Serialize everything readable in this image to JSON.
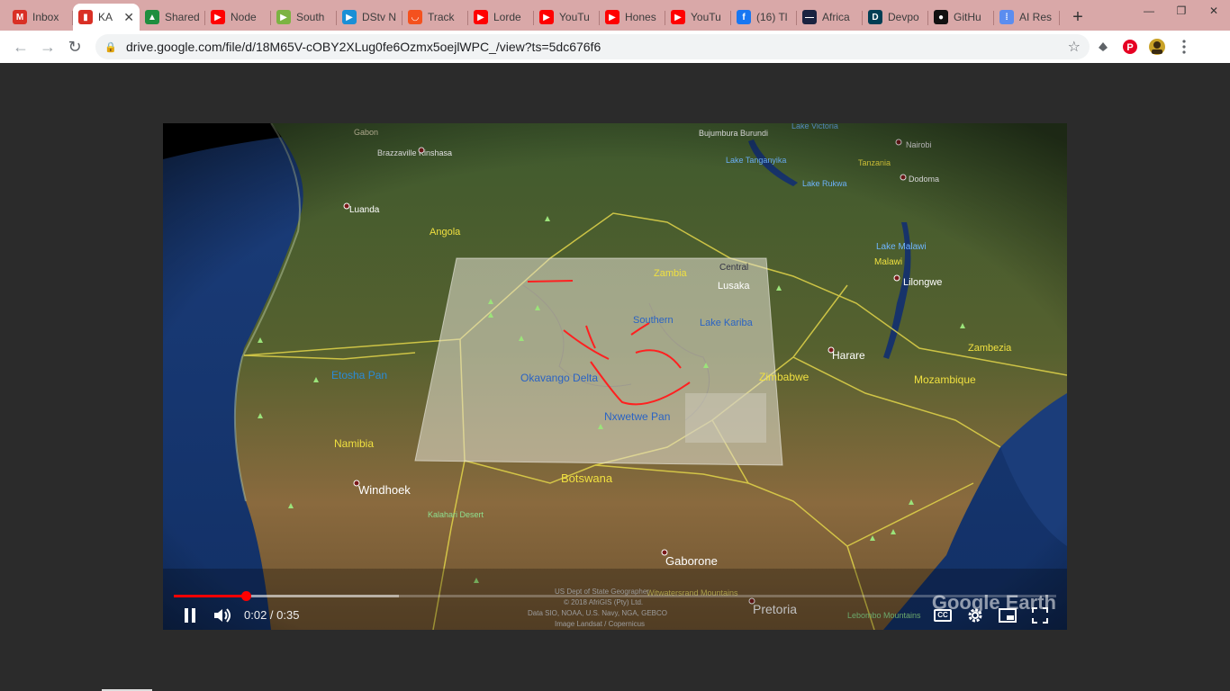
{
  "tabs": [
    {
      "label": "Inbox",
      "icon": "gmail-icon",
      "color": "#d93025",
      "glyph": "M"
    },
    {
      "label": "KA",
      "icon": "clapper-icon",
      "color": "#d93025",
      "glyph": "▮",
      "active": true
    },
    {
      "label": "Shared",
      "icon": "drive-icon",
      "color": "#1e8e3e",
      "glyph": "▲"
    },
    {
      "label": "Node",
      "icon": "youtube-icon",
      "color": "#ff0000",
      "glyph": "▶"
    },
    {
      "label": "South",
      "icon": "play-icon",
      "color": "#7cb342",
      "glyph": "▶"
    },
    {
      "label": "DStv N",
      "icon": "dstv-icon",
      "color": "#1a8fd6",
      "glyph": "▶"
    },
    {
      "label": "Track",
      "icon": "tracker-icon",
      "color": "#f4511e",
      "glyph": "◡"
    },
    {
      "label": "Lorde",
      "icon": "youtube-icon",
      "color": "#ff0000",
      "glyph": "▶"
    },
    {
      "label": "YouTu",
      "icon": "youtube-icon",
      "color": "#ff0000",
      "glyph": "▶"
    },
    {
      "label": "Hones",
      "icon": "youtube-icon",
      "color": "#ff0000",
      "glyph": "▶"
    },
    {
      "label": "YouTu",
      "icon": "youtube-icon",
      "color": "#ff0000",
      "glyph": "▶"
    },
    {
      "label": "(16) Tl",
      "icon": "facebook-icon",
      "color": "#1877f2",
      "glyph": "f"
    },
    {
      "label": "Africa",
      "icon": "africa-icon",
      "color": "#1a2340",
      "glyph": "—"
    },
    {
      "label": "Devpo",
      "icon": "devpost-icon",
      "color": "#003e54",
      "glyph": "D"
    },
    {
      "label": "GitHu",
      "icon": "github-icon",
      "color": "#111111",
      "glyph": "●"
    },
    {
      "label": "AI Res",
      "icon": "ai-res-icon",
      "color": "#5b8def",
      "glyph": "⁞"
    }
  ],
  "address": {
    "url": "drive.google.com/file/d/18M65V-cOBY2XLug0fe6Ozmx5oejlWPC_/view?ts=5dc676f6"
  },
  "map": {
    "countries": [
      "Angola",
      "Zambia",
      "Namibia",
      "Botswana",
      "Zimbabwe",
      "Mozambique",
      "Malawi",
      "Tanzania",
      "Zambezia",
      "Gabon"
    ],
    "cities": [
      "Brazzaville Kinshasa",
      "Luanda",
      "Lusaka",
      "Harare",
      "Lilongwe",
      "Windhoek",
      "Gaborone",
      "Pretoria",
      "Nairobi",
      "Dodoma",
      "Bujumbura Burundi"
    ],
    "features": [
      "Etosha Pan",
      "Okavango Delta",
      "Nxwetwe Pan",
      "Lake Kariba",
      "Lake Malawi",
      "Lake Tanganyika",
      "Lake Rukwa",
      "Lake Victoria",
      "Kalahari Desert",
      "Southern",
      "Central",
      "Witwatersrand Mountains",
      "Lebombo Mountains"
    ],
    "credits": [
      "US Dept of State Geographer",
      "© 2018 AfriGIS (Pty) Ltd.",
      "Data SIO, NOAA, U.S. Navy, NGA, GEBCO",
      "Image Landsat / Copernicus"
    ],
    "watermark": "Google Earth"
  },
  "player": {
    "time": "0:02 / 0:35",
    "played_fraction": 0.082,
    "buffered_fraction": 0.255,
    "cc_label": "CC"
  }
}
